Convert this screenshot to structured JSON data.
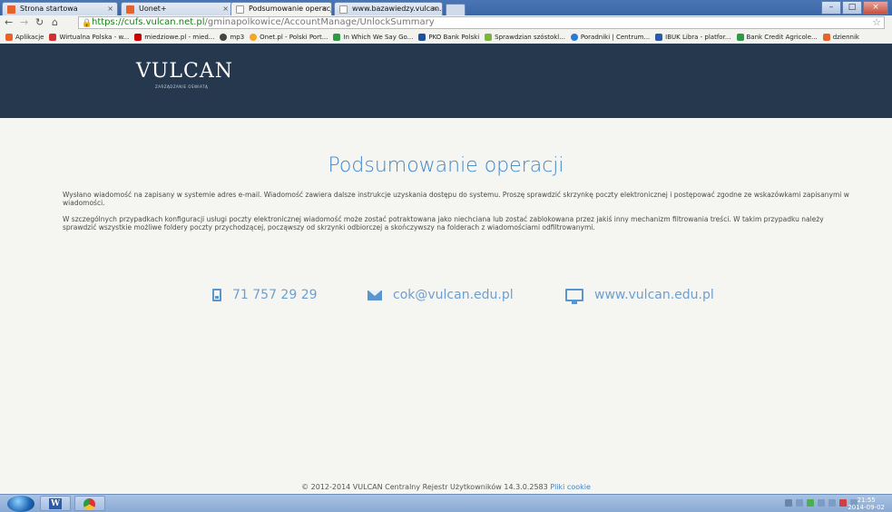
{
  "browser": {
    "tabs": [
      {
        "label": "Strona startowa",
        "favicon_color": "#e8632b"
      },
      {
        "label": "Uonet+",
        "favicon_color": "#e8632b"
      },
      {
        "label": "Podsumowanie operacji",
        "favicon_color": "#ffffff"
      },
      {
        "label": "www.bazawiedzy.vulcan.e",
        "favicon_color": "#ffffff"
      }
    ],
    "url_scheme": "https://",
    "url_host": "cufs.vulcan.net.pl",
    "url_path": "/gminapolkowice/AccountManage/UnlockSummary",
    "bookmarks": [
      {
        "label": "Aplikacje",
        "color": "#e8632b"
      },
      {
        "label": "Wirtualna Polska - w...",
        "color": "#d03030"
      },
      {
        "label": "miedziowe.pl - mied...",
        "color": "#cc0000"
      },
      {
        "label": "mp3",
        "color": "#444444"
      },
      {
        "label": "Onet.pl - Polski Port...",
        "color": "#f5a623"
      },
      {
        "label": "In Which We Say Go...",
        "color": "#2e9a48"
      },
      {
        "label": "PKO Bank Polski",
        "color": "#1e4f9c"
      },
      {
        "label": "Sprawdzian szóstokl...",
        "color": "#7cb342"
      },
      {
        "label": "Poradniki | Centrum...",
        "color": "#2b7bd1"
      },
      {
        "label": "IBUK Libra - platfor...",
        "color": "#2b5aa8"
      },
      {
        "label": "Bank Credit Agricole...",
        "color": "#2e9a48"
      },
      {
        "label": "dziennik",
        "color": "#e8632b"
      }
    ]
  },
  "brand": {
    "logo": "VULCAN",
    "logo_sub": "ZARZĄDZANIE OŚWIATĄ",
    "header_color": "#26384d",
    "accent": "#3f86c9"
  },
  "page": {
    "title": "Podsumowanie operacji",
    "paragraph1": "Wysłano wiadomość na zapisany w systemie adres e-mail. Wiadomość zawiera dalsze instrukcje uzyskania dostępu do systemu. Proszę sprawdzić skrzynkę poczty elektronicznej i postępować zgodne ze wskazówkami zapisanymi w wiadomości.",
    "paragraph2": "W szczególnych przypadkach konfiguracji usługi poczty elektronicznej wiadomość może zostać potraktowana jako niechciana lub zostać zablokowana przez jakiś inny mechanizm filtrowania treści. W takim przypadku należy sprawdzić wszystkie możliwe foldery poczty przychodzącej, począwszy od skrzynki odbiorczej a skończywszy na folderach z wiadomościami odfiltrowanymi."
  },
  "contacts": {
    "phone": "71 757 29 29",
    "email": "cok@vulcan.edu.pl",
    "website": "www.vulcan.edu.pl"
  },
  "footer": {
    "text": "© 2012-2014 VULCAN Centralny Rejestr Użytkowników 14.3.0.2583",
    "cookie_link": "Pliki cookie"
  },
  "taskbar": {
    "time": "21:55",
    "date": "2014-09-02"
  }
}
